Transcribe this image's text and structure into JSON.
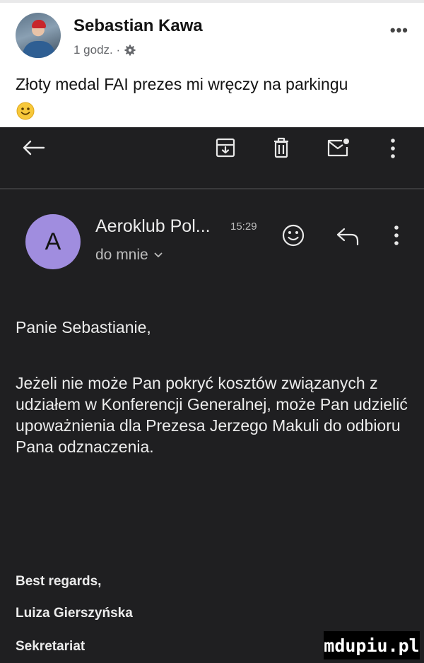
{
  "post": {
    "author": "Sebastian Kawa",
    "time": "1 godz. ·",
    "text": "Złoty medal FAI prezes mi wręczy na parkingu",
    "more": "•••"
  },
  "email": {
    "sender": "Aeroklub Pol...",
    "time": "15:29",
    "avatar_letter": "A",
    "recipient": "do mnie",
    "greeting": "Panie Sebastianie,",
    "body": "Jeżeli nie może Pan pokryć kosztów związanych z udziałem w Konferencji Generalnej, może Pan udzielić upoważnienia dla Prezesa Jerzego Makuli do odbioru Pana odznaczenia.",
    "signature": {
      "regards": "Best regards,",
      "name": "Luiza Gierszyńska",
      "role": "Sekretariat"
    }
  },
  "watermark": "mdupiu.pl",
  "colors": {
    "dark_bg": "#1f1f21",
    "avatar_purple": "#a08ddf",
    "text_light": "#ececec"
  },
  "icons": [
    "back-arrow-icon",
    "archive-icon",
    "delete-icon",
    "mark-unread-icon",
    "more-vert-icon",
    "emoji-react-icon",
    "reply-icon",
    "gear-icon",
    "smiley-icon"
  ]
}
